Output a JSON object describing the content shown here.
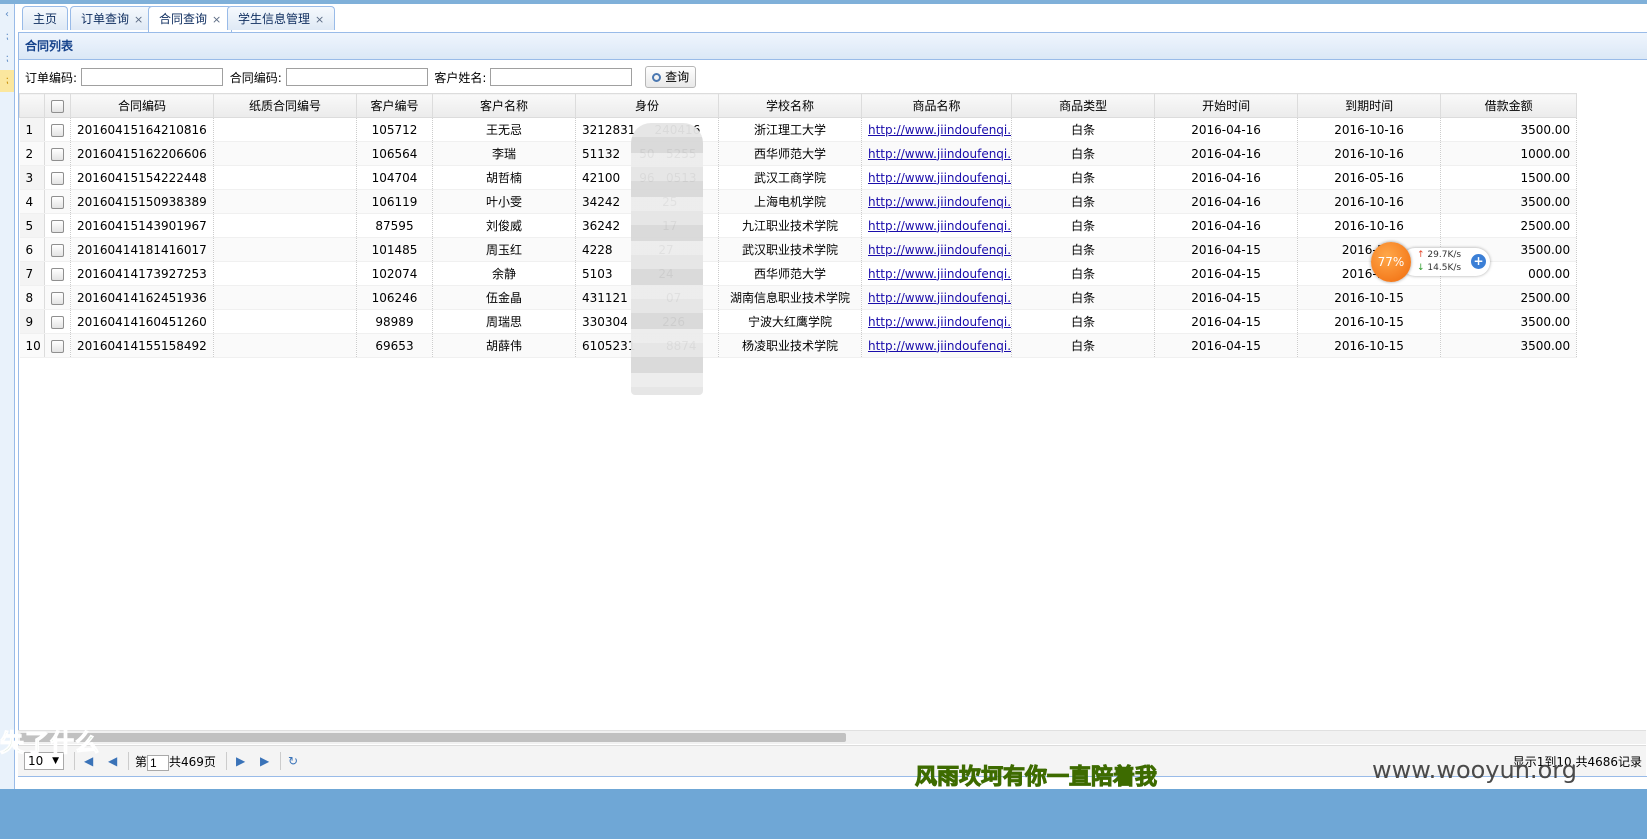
{
  "tabs": [
    {
      "label": "主页",
      "closable": false
    },
    {
      "label": "订单查询",
      "closable": true
    },
    {
      "label": "合同查询",
      "closable": true,
      "active": true
    },
    {
      "label": "学生信息管理",
      "closable": true
    }
  ],
  "panel": {
    "title": "合同列表"
  },
  "search": {
    "order_code_label": "订单编码:",
    "order_code_value": "",
    "contract_code_label": "合同编码:",
    "contract_code_value": "",
    "customer_name_label": "客户姓名:",
    "customer_name_value": "",
    "query_button": "查询"
  },
  "columns": [
    "合同编码",
    "纸质合同编号",
    "客户编号",
    "客户名称",
    "身份",
    "学校名称",
    "商品名称",
    "商品类型",
    "开始时间",
    "到期时间",
    "借款金额"
  ],
  "rows": [
    {
      "n": "1",
      "contract": "20160415164210816",
      "paper": "",
      "cust_id": "105712",
      "name": "王无忌",
      "idno": "3212831     240416",
      "school": "浙江理工大学",
      "product": "http://www.jiindoufenqi.",
      "type": "白条",
      "start": "2016-04-16",
      "end": "2016-10-16",
      "amount": "3500.00"
    },
    {
      "n": "2",
      "contract": "20160415162206606",
      "paper": "",
      "cust_id": "106564",
      "name": "李瑞",
      "idno": "51132     50   5255",
      "school": "西华师范大学",
      "product": "http://www.jiindoufenqi.",
      "type": "白条",
      "start": "2016-04-16",
      "end": "2016-10-16",
      "amount": "1000.00"
    },
    {
      "n": "3",
      "contract": "20160415154222448",
      "paper": "",
      "cust_id": "104704",
      "name": "胡哲楠",
      "idno": "42100     96   0513",
      "school": "武汉工商学院",
      "product": "http://www.jiindoufenqi.",
      "type": "白条",
      "start": "2016-04-16",
      "end": "2016-05-16",
      "amount": "1500.00"
    },
    {
      "n": "4",
      "contract": "20160415150938389",
      "paper": "",
      "cust_id": "106119",
      "name": "叶小雯",
      "idno": "34242           25",
      "school": "上海电机学院",
      "product": "http://www.jiindoufenqi.",
      "type": "白条",
      "start": "2016-04-16",
      "end": "2016-10-16",
      "amount": "3500.00"
    },
    {
      "n": "5",
      "contract": "20160415143901967",
      "paper": "",
      "cust_id": "87595",
      "name": "刘俊威",
      "idno": "36242           17",
      "school": "九江职业技术学院",
      "product": "http://www.jiindoufenqi.",
      "type": "白条",
      "start": "2016-04-16",
      "end": "2016-10-16",
      "amount": "2500.00"
    },
    {
      "n": "6",
      "contract": "20160414181416017",
      "paper": "",
      "cust_id": "101485",
      "name": "周玉红",
      "idno": "4228            27",
      "school": "武汉职业技术学院",
      "product": "http://www.jiindoufenqi.",
      "type": "白条",
      "start": "2016-04-15",
      "end": "2016-10-",
      "amount": "3500.00"
    },
    {
      "n": "7",
      "contract": "20160414173927253",
      "paper": "",
      "cust_id": "102074",
      "name": "余静",
      "idno": "5103            24",
      "school": "西华师范大学",
      "product": "http://www.jiindoufenqi.",
      "type": "白条",
      "start": "2016-04-15",
      "end": "2016-10-",
      "amount": "000.00"
    },
    {
      "n": "8",
      "contract": "20160414162451936",
      "paper": "",
      "cust_id": "106246",
      "name": "伍金晶",
      "idno": "431121          07",
      "school": "湖南信息职业技术学院",
      "product": "http://www.jiindoufenqi.",
      "type": "白条",
      "start": "2016-04-15",
      "end": "2016-10-15",
      "amount": "2500.00"
    },
    {
      "n": "9",
      "contract": "20160414160451260",
      "paper": "",
      "cust_id": "98989",
      "name": "周瑞思",
      "idno": "330304         226",
      "school": "宁波大红鹰学院",
      "product": "http://www.jiindoufenqi.",
      "type": "白条",
      "start": "2016-04-15",
      "end": "2016-10-15",
      "amount": "3500.00"
    },
    {
      "n": "10",
      "contract": "20160414155158492",
      "paper": "",
      "cust_id": "69653",
      "name": "胡薛伟",
      "idno": "6105231        8874",
      "school": "杨凌职业技术学院",
      "product": "http://www.jiindoufenqi.",
      "type": "白条",
      "start": "2016-04-15",
      "end": "2016-10-15",
      "amount": "3500.00"
    }
  ],
  "pager": {
    "page_size": "10",
    "page_prefix": "第",
    "page_value": "1",
    "page_total": "共469页",
    "info": "显示1到10,共4686记录"
  },
  "speed_widget": {
    "percent": "77%",
    "up": "29.7K/s",
    "down": "14.5K/s"
  },
  "overlays": {
    "left": "失了什么",
    "center": "风雨坎坷有你一直陪着我",
    "watermark": "www.wooyun.org"
  },
  "colors": {
    "accent": "#99bbe8",
    "header_text": "#15428b",
    "link": "#1a0dab",
    "footer": "#6fa7d6"
  },
  "icons": {
    "search": "magnifier-icon",
    "first": "first-page-icon",
    "prev": "prev-page-icon",
    "next": "next-page-icon",
    "last": "last-page-icon",
    "refresh": "refresh-icon"
  }
}
